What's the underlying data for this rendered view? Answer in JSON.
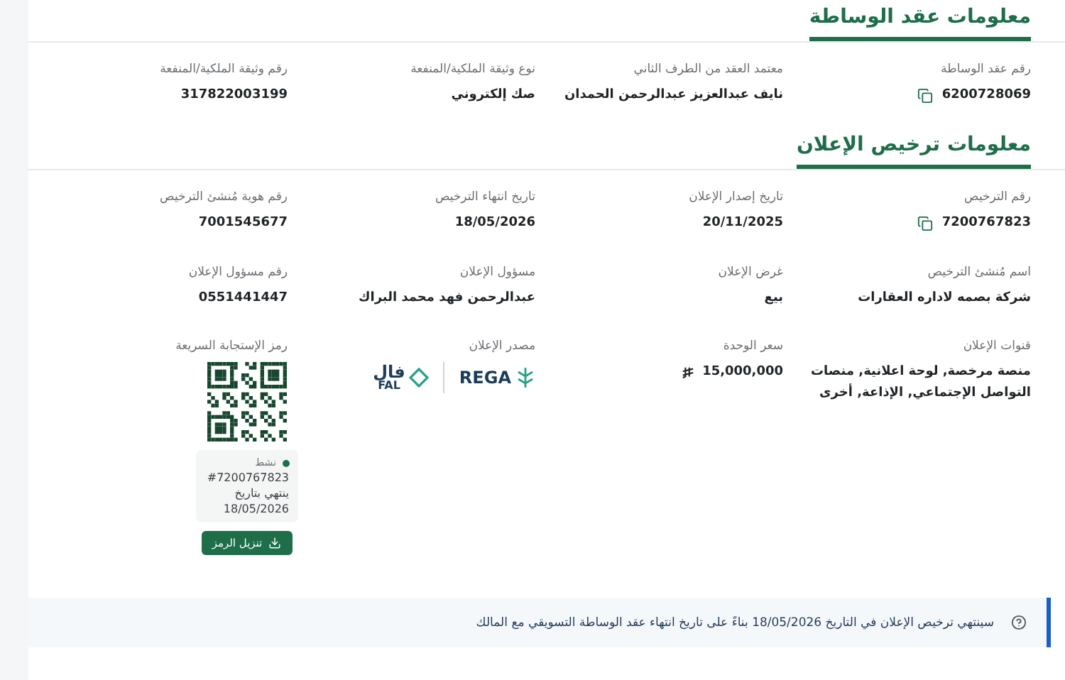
{
  "contract_section": {
    "title": "معلومات عقد الوساطة",
    "fields": [
      {
        "kind": "copyable",
        "label": "رقم عقد الوساطة",
        "value": "6200728069"
      },
      {
        "kind": "text",
        "label": "معتمد العقد من الطرف الثاني",
        "value": "نايف عبدالعزيز عبدالرحمن الحمدان"
      },
      {
        "kind": "text",
        "label": "نوع وثيقة الملكية/المنفعة",
        "value": "صك إلكتروني"
      },
      {
        "kind": "text",
        "label": "رقم وثيقة الملكية/المنفعة",
        "value": "317822003199"
      }
    ]
  },
  "license_section": {
    "title": "معلومات ترخيص الإعلان",
    "fields": [
      {
        "kind": "copyable",
        "label": "رقم الترخيص",
        "value": "7200767823"
      },
      {
        "kind": "text",
        "label": "تاريخ إصدار الإعلان",
        "value": "20/11/2025"
      },
      {
        "kind": "text",
        "label": "تاريخ انتهاء الترخيص",
        "value": "18/05/2026"
      },
      {
        "kind": "text",
        "label": "رقم هوية مُنشئ الترخيص",
        "value": "7001545677"
      },
      {
        "kind": "text",
        "label": "اسم مُنشئ الترخيص",
        "value": "شركة بصمه لاداره العقارات"
      },
      {
        "kind": "text",
        "label": "غرض الإعلان",
        "value": "بيع"
      },
      {
        "kind": "text",
        "label": "مسؤول الإعلان",
        "value": "عبدالرحمن فهد محمد البراك"
      },
      {
        "kind": "text",
        "label": "رقم مسؤول الإعلان",
        "value": "0551441447"
      },
      {
        "kind": "text",
        "label": "قنوات الإعلان",
        "value": "منصة مرخصة, لوحة اعلانية, منصات التواصل الإجتماعي, الإذاعة, أخرى"
      },
      {
        "kind": "price",
        "label": "سعر الوحدة",
        "value": "15,000,000"
      },
      {
        "kind": "logos",
        "label": "مصدر الإعلان",
        "rega": "REGA",
        "fal_ar": "فال",
        "fal_en": "FAL"
      },
      {
        "kind": "qr",
        "label": "رمز الإستجابة السريعة",
        "status": "نشط",
        "number": "#7200767823",
        "expiry_label": "ينتهي بتاريخ",
        "expiry_date": "18/05/2026",
        "button": "تنزيل الرمز"
      }
    ]
  },
  "notice": "سينتهي ترخيص الإعلان في التاريخ 18/05/2026 بناءً على تاريخ انتهاء عقد الوساطة التسويقي مع المالك"
}
